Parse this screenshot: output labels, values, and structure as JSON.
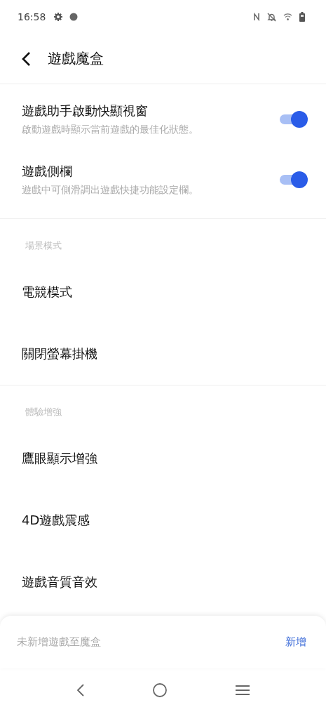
{
  "status_bar": {
    "time": "16:58"
  },
  "header": {
    "title": "遊戲魔盒"
  },
  "sections": [
    {
      "items": [
        {
          "kind": "toggle",
          "title": "遊戲助手啟動快顯視窗",
          "subtitle": "啟動遊戲時顯示當前遊戲的最佳化狀態。",
          "on": true
        },
        {
          "kind": "toggle",
          "title": "遊戲側欄",
          "subtitle": "遊戲中可側滑調出遊戲快捷功能設定欄。",
          "on": true
        }
      ]
    },
    {
      "header": "場景模式",
      "items": [
        {
          "kind": "link",
          "title": "電競模式"
        },
        {
          "kind": "link",
          "title": "關閉螢幕掛機"
        }
      ]
    },
    {
      "header": "體驗增強",
      "items": [
        {
          "kind": "link",
          "title": "鷹眼顯示增強"
        },
        {
          "kind": "link",
          "title": "4D遊戲震感"
        },
        {
          "kind": "link",
          "title": "遊戲音質音效"
        }
      ]
    }
  ],
  "bottom_sheet": {
    "message": "未新增遊戲至魔盒",
    "action": "新增"
  }
}
